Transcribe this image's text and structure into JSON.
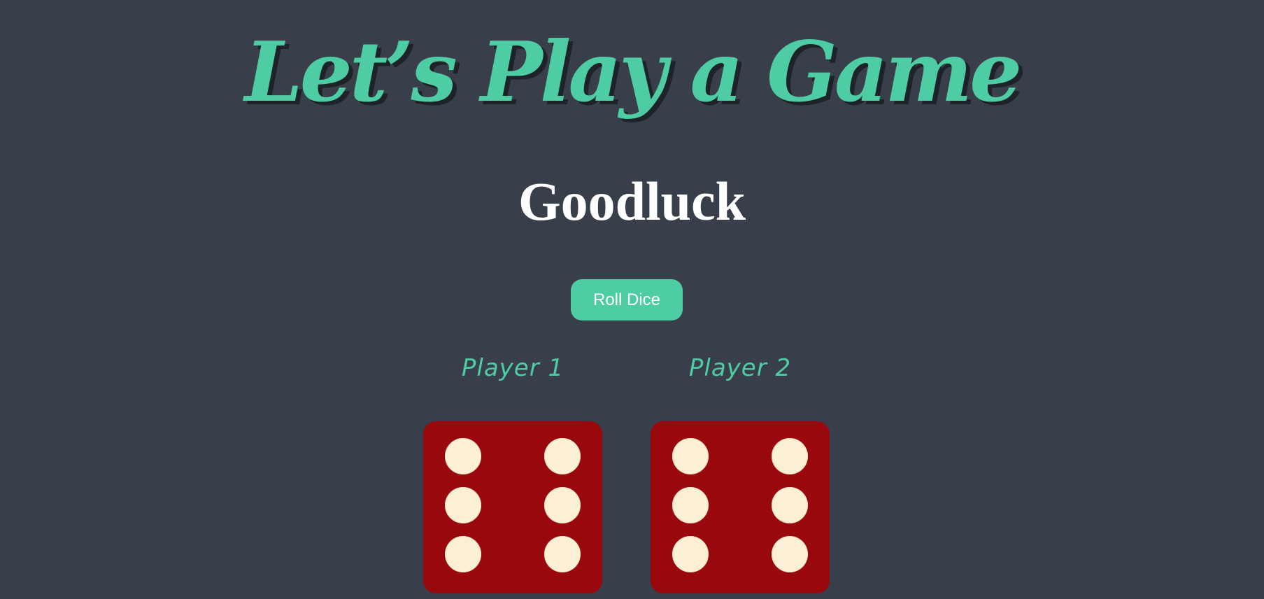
{
  "header": {
    "title": "Let’s Play a Game",
    "subtitle": "Goodluck"
  },
  "controls": {
    "roll_button_label": "Roll Dice"
  },
  "players": [
    {
      "name": "Player 1",
      "die_value": 6
    },
    {
      "name": "Player 2",
      "die_value": 6
    }
  ],
  "colors": {
    "background": "#393f4a",
    "accent": "#4ecca3",
    "die_face": "#99080d",
    "pip": "#fbefd6"
  }
}
